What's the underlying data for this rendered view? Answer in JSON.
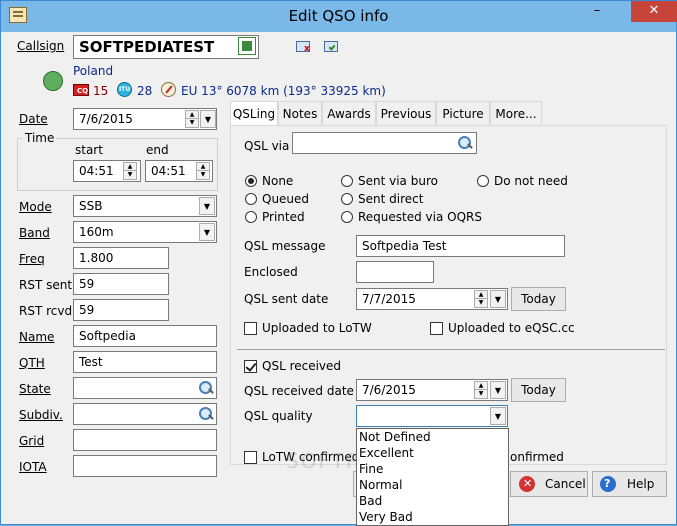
{
  "window": {
    "title": "Edit QSO info",
    "min": "–",
    "max": "☐",
    "close": "✕"
  },
  "callsign": {
    "label": "Callsign",
    "value": "SOFTPEDIATEST"
  },
  "location": {
    "country": "Poland",
    "cq_zone": "15",
    "itu_zone": "28",
    "info": "EU 13°  6078 km (193°  33925 km)"
  },
  "form": {
    "date_label": "Date",
    "date_value": "7/6/2015",
    "time_group": "Time",
    "start_label": "start",
    "start_value": "04:51",
    "end_label": "end",
    "end_value": "04:51",
    "mode_label": "Mode",
    "mode_value": "SSB",
    "band_label": "Band",
    "band_value": "160m",
    "freq_label": "Freq",
    "freq_value": "1.800",
    "rst_sent_label": "RST sent",
    "rst_sent_value": "59",
    "rst_rcvd_label": "RST rcvd",
    "rst_rcvd_value": "59",
    "name_label": "Name",
    "name_value": "Softpedia",
    "qth_label": "QTH",
    "qth_value": "Test",
    "state_label": "State",
    "state_value": "",
    "subdiv_label": "Subdiv.",
    "subdiv_value": "",
    "grid_label": "Grid",
    "grid_value": "",
    "iota_label": "IOTA",
    "iota_value": ""
  },
  "tabs": [
    "QSLing",
    "Notes",
    "Awards",
    "Previous",
    "Picture",
    "More..."
  ],
  "qsl": {
    "via_label": "QSL via",
    "via_value": "",
    "radio_none": "None",
    "radio_queued": "Queued",
    "radio_printed": "Printed",
    "radio_sent_buro": "Sent via buro",
    "radio_sent_direct": "Sent direct",
    "radio_requested_oqrs": "Requested via OQRS",
    "radio_do_not_need": "Do not need",
    "message_label": "QSL message",
    "message_value": "Softpedia Test",
    "enclosed_label": "Enclosed",
    "enclosed_value": "",
    "sent_date_label": "QSL sent date",
    "sent_date_value": "7/7/2015",
    "today_label": "Today",
    "uploaded_lotw_label": "Uploaded to LoTW",
    "uploaded_eqsl_label": "Uploaded to eQSC.cc",
    "received_label": "QSL received",
    "received_date_label": "QSL received date",
    "received_date_value": "7/6/2015",
    "quality_label": "QSL quality",
    "quality_value": "",
    "lotw_confirmed_label": "LoTW confirmed",
    "eqsl_confirmed_tail": "onfirmed",
    "quality_options": [
      "Not Defined",
      "Excellent",
      "Fine",
      "Normal",
      "Bad",
      "Very Bad"
    ]
  },
  "buttons": {
    "cancel": "Cancel",
    "help": "Help"
  },
  "watermark": "SOFTPEDIA"
}
